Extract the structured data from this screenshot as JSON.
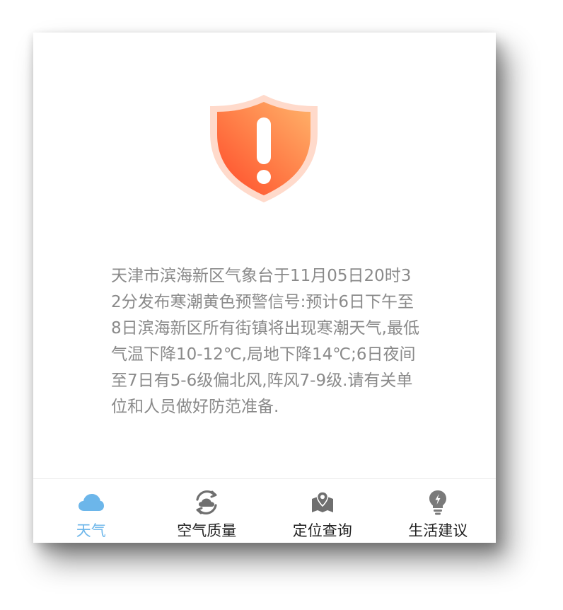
{
  "alert": {
    "message": "天津市滨海新区气象台于11月05日20时32分发布寒潮黄色预警信号:预计6日下午至8日滨海新区所有街镇将出现寒潮天气,最低气温下降10-12℃,局地下降14℃;6日夜间至7日有5-6级偏北风,阵风7-9级.请有关单位和人员做好防范准备.",
    "icon": "warning-shield-icon"
  },
  "tabs": [
    {
      "label": "天气",
      "icon": "cloud-icon",
      "active": true
    },
    {
      "label": "空气质量",
      "icon": "air-quality-icon",
      "active": false
    },
    {
      "label": "定位查询",
      "icon": "location-map-icon",
      "active": false
    },
    {
      "label": "生活建议",
      "icon": "lightbulb-icon",
      "active": false
    }
  ],
  "colors": {
    "accent": "#6cb6ea",
    "shield_top": "#ffb36a",
    "shield_bottom": "#ff4a2a",
    "text_gray": "#8a8a8a",
    "icon_gray": "#6f6f6f"
  }
}
